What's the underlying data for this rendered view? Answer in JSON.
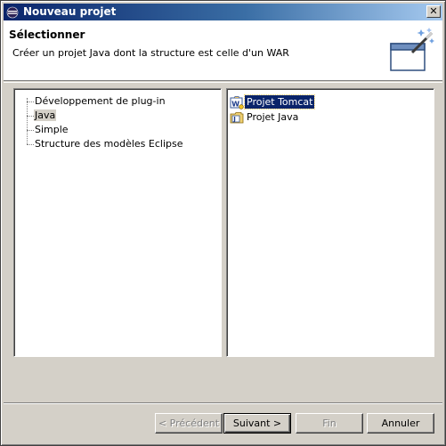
{
  "window": {
    "title": "Nouveau projet",
    "close_label": "✕"
  },
  "header": {
    "title": "Sélectionner",
    "description": "Créer un projet Java dont la structure est celle d'un WAR",
    "graphic": "new-project-wizard-icon"
  },
  "categories": {
    "items": [
      {
        "label": "Développement de plug-in",
        "selected": false
      },
      {
        "label": "Java",
        "selected": true
      },
      {
        "label": "Simple",
        "selected": false
      },
      {
        "label": "Structure des modèles Eclipse",
        "selected": false
      }
    ]
  },
  "wizards": {
    "items": [
      {
        "label": "Projet Tomcat",
        "icon": "tomcat-project-icon",
        "selected": true
      },
      {
        "label": "Projet Java",
        "icon": "java-project-icon",
        "selected": false
      }
    ]
  },
  "buttons": {
    "back": "< Précédent",
    "next": "Suivant >",
    "finish": "Fin",
    "cancel": "Annuler"
  },
  "colors": {
    "titlebar": "#0a246a",
    "selection": "#0a246a",
    "face": "#d4d0c8"
  }
}
